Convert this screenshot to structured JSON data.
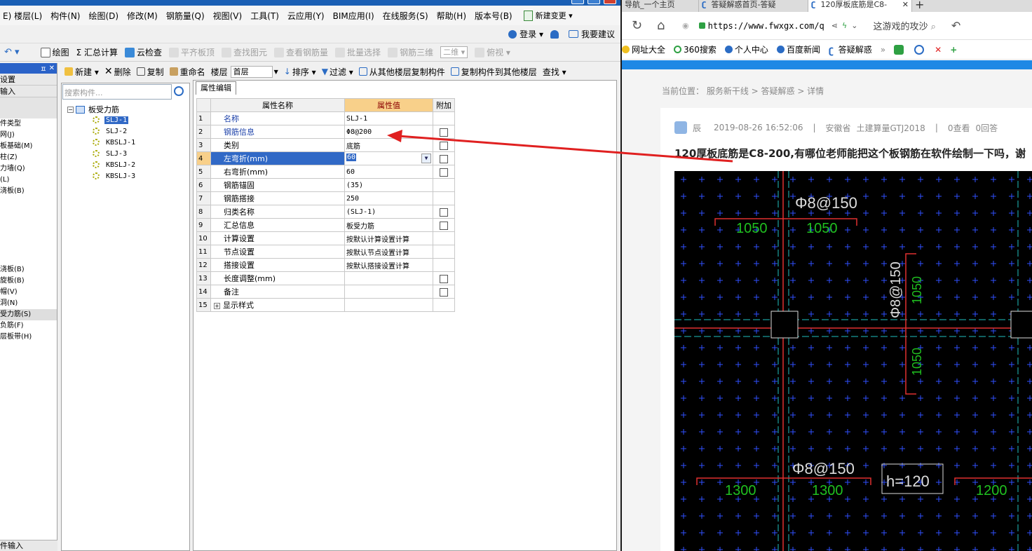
{
  "app": {
    "menu": [
      "E) 楼层(L)",
      "构件(N)",
      "绘图(D)",
      "修改(M)",
      "钢筋量(Q)",
      "视图(V)",
      "工具(T)",
      "云应用(Y)",
      "BIM应用(I)",
      "在线服务(S)",
      "帮助(H)",
      "版本号(B)"
    ],
    "new_change": "新建变更 ▾",
    "login": "登录 ▾",
    "suggest": "我要建议",
    "toolbar1": [
      "绘图",
      "Σ 汇总计算",
      "云检查",
      "平齐板顶",
      "查找图元",
      "查看钢筋量",
      "批量选择",
      "钢筋三维",
      "二维 ▾",
      "俯视 ▾"
    ],
    "toolbar1_disabled": [
      false,
      false,
      false,
      true,
      true,
      true,
      true,
      true,
      true,
      true
    ],
    "toolbar2": {
      "new": "新建 ▾",
      "delete": "删除",
      "copy": "复制",
      "rename": "重命名",
      "floor_label": "楼层",
      "floor_value": "首层",
      "sort": "排序 ▾",
      "filter": "过滤 ▾",
      "copy_from": "从其他楼层复制构件",
      "copy_to": "复制构件到其他楼层",
      "find": "查找 ▾"
    },
    "nav": {
      "sections": [
        "设置",
        "输入"
      ],
      "items": [
        "件类型",
        "网(J)",
        "板基础(M)",
        "柱(Z)",
        "力墙(Q)",
        "(L)",
        "浇板(B)",
        "浇板(B)",
        "旋板(B)",
        "帽(V)",
        "洞(N)",
        "受力筋(S)",
        "负筋(F)",
        "层板带(H)"
      ],
      "bottom": "件输入"
    },
    "tree": {
      "search_placeholder": "搜索构件...",
      "root": "板受力筋",
      "items": [
        "SLJ-1",
        "SLJ-2",
        "KBSLJ-1",
        "SLJ-3",
        "KBSLJ-2",
        "KBSLJ-3"
      ]
    },
    "prop": {
      "tab": "属性编辑",
      "headers": [
        "属性名称",
        "属性值",
        "附加"
      ],
      "rows": [
        {
          "idx": "1",
          "name": "名称",
          "value": "SLJ-1",
          "check": false
        },
        {
          "idx": "2",
          "name": "钢筋信息",
          "value": "Φ8@200",
          "check": true
        },
        {
          "idx": "3",
          "name": "类别",
          "value": "底筋",
          "check": true
        },
        {
          "idx": "4",
          "name": "左弯折(mm)",
          "value": "60",
          "check": true
        },
        {
          "idx": "5",
          "name": "右弯折(mm)",
          "value": "60",
          "check": true
        },
        {
          "idx": "6",
          "name": "钢筋锚固",
          "value": "(35)",
          "check": false
        },
        {
          "idx": "7",
          "name": "钢筋搭接",
          "value": "250",
          "check": false
        },
        {
          "idx": "8",
          "name": "归类名称",
          "value": "(SLJ-1)",
          "check": true
        },
        {
          "idx": "9",
          "name": "汇总信息",
          "value": "板受力筋",
          "check": true
        },
        {
          "idx": "10",
          "name": "计算设置",
          "value": "按默认计算设置计算",
          "check": false
        },
        {
          "idx": "11",
          "name": "节点设置",
          "value": "按默认节点设置计算",
          "check": false
        },
        {
          "idx": "12",
          "name": "搭接设置",
          "value": "按默认搭接设置计算",
          "check": false
        },
        {
          "idx": "13",
          "name": "长度调整(mm)",
          "value": "",
          "check": true
        },
        {
          "idx": "14",
          "name": "备注",
          "value": "",
          "check": true
        },
        {
          "idx": "15",
          "name": "显示样式",
          "value": "",
          "check": false
        }
      ]
    }
  },
  "browser": {
    "tabs": [
      "导航_一个主页",
      "答疑解惑首页-答疑",
      "120厚板底筋是C8-"
    ],
    "url": "https://www.fwxgx.com/q",
    "search_text": "这游戏的攻沙",
    "bookmarks": [
      "网址大全",
      "360搜索",
      "个人中心",
      "百度新闻",
      "答疑解惑"
    ],
    "breadcrumb": "当前位置： 服务新干线 > 答疑解惑 > 详情",
    "meta": {
      "user": "辰",
      "date": "2019-08-26 16:52:06",
      "region": "安徽省",
      "software": "土建算量GTJ2018",
      "views": "0查看",
      "answers": "0回答"
    },
    "question_title": "120厚板底筋是C8-200,有哪位老师能把这个板钢筋在软件绘制一下吗，谢",
    "cad_labels": {
      "rebar1": "Φ8@150",
      "rebar2": "Φ8@150",
      "rebar3": "Φ8@150",
      "d1": "1050",
      "d2": "1050",
      "d3": "1050",
      "d4": "1050",
      "d5": "1300",
      "d6": "1300",
      "d7": "1200",
      "thickness": "h=120"
    }
  },
  "colors": {
    "accent": "#3169c6",
    "header_value": "#f8d08a",
    "arrow": "#e02020",
    "cad_green": "#20c020",
    "cad_red": "#e03030",
    "cad_cyan": "#20c0c0",
    "cad_blue_grid": "#3050ff"
  }
}
